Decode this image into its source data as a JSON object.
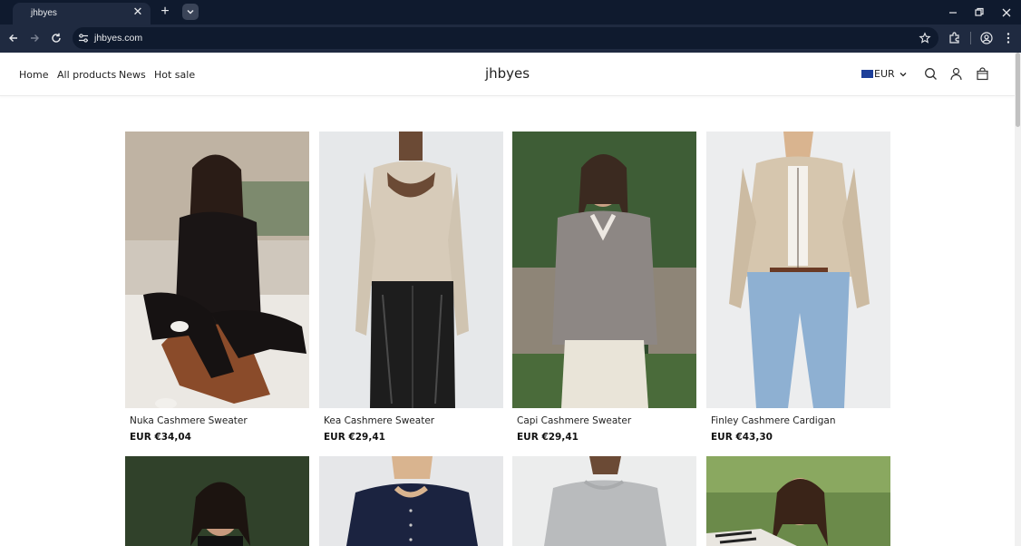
{
  "browser": {
    "tab_title": "jhbyes",
    "url": "jhbyes.com"
  },
  "header": {
    "nav": [
      "Home",
      "All products",
      "News",
      "Hot sale"
    ],
    "brand": "jhbyes",
    "currency": "EUR"
  },
  "products": [
    {
      "name": "Nuka Cashmere Sweater",
      "price": "EUR €34,04"
    },
    {
      "name": "Kea Cashmere Sweater",
      "price": "EUR €29,41"
    },
    {
      "name": "Capi Cashmere Sweater",
      "price": "EUR €29,41"
    },
    {
      "name": "Finley Cashmere Cardigan",
      "price": "EUR €43,30"
    }
  ],
  "colors": {
    "tabbar": "#0f1a2e",
    "toolbar": "#1f2a40",
    "accent_flag": "#1d3f99"
  }
}
